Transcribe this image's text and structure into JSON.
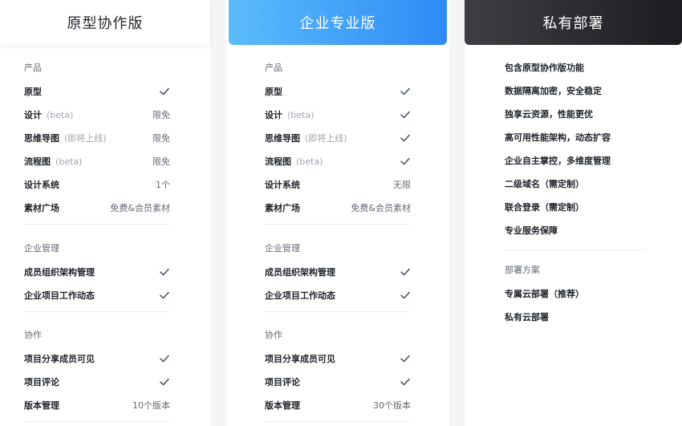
{
  "plans": [
    {
      "name": "原型协作版",
      "sections": [
        {
          "title": "产品",
          "items": [
            {
              "label": "原型",
              "note": "",
              "value": "",
              "check": true
            },
            {
              "label": "设计",
              "note": "(beta)",
              "value": "限免",
              "check": false
            },
            {
              "label": "思维导图",
              "note": "(即将上线)",
              "value": "限免",
              "check": false
            },
            {
              "label": "流程图",
              "note": "(beta)",
              "value": "限免",
              "check": false
            },
            {
              "label": "设计系统",
              "note": "",
              "value": "1个",
              "check": false
            },
            {
              "label": "素材广场",
              "note": "",
              "value": "免费&会员素材",
              "check": false
            }
          ]
        },
        {
          "title": "企业管理",
          "items": [
            {
              "label": "成员组织架构管理",
              "note": "",
              "value": "",
              "check": true
            },
            {
              "label": "企业项目工作动态",
              "note": "",
              "value": "",
              "check": true
            }
          ]
        },
        {
          "title": "协作",
          "items": [
            {
              "label": "项目分享成员可见",
              "note": "",
              "value": "",
              "check": true
            },
            {
              "label": "项目评论",
              "note": "",
              "value": "",
              "check": true
            },
            {
              "label": "版本管理",
              "note": "",
              "value": "10个版本",
              "check": false
            }
          ]
        }
      ]
    },
    {
      "name": "企业专业版",
      "sections": [
        {
          "title": "产品",
          "items": [
            {
              "label": "原型",
              "note": "",
              "value": "",
              "check": true
            },
            {
              "label": "设计",
              "note": "(beta)",
              "value": "",
              "check": true
            },
            {
              "label": "思维导图",
              "note": "(即将上线)",
              "value": "",
              "check": true
            },
            {
              "label": "流程图",
              "note": "(beta)",
              "value": "",
              "check": true
            },
            {
              "label": "设计系统",
              "note": "",
              "value": "无限",
              "check": false
            },
            {
              "label": "素材广场",
              "note": "",
              "value": "免费&会员素材",
              "check": false
            }
          ]
        },
        {
          "title": "企业管理",
          "items": [
            {
              "label": "成员组织架构管理",
              "note": "",
              "value": "",
              "check": true
            },
            {
              "label": "企业项目工作动态",
              "note": "",
              "value": "",
              "check": true
            }
          ]
        },
        {
          "title": "协作",
          "items": [
            {
              "label": "项目分享成员可见",
              "note": "",
              "value": "",
              "check": true
            },
            {
              "label": "项目评论",
              "note": "",
              "value": "",
              "check": true
            },
            {
              "label": "版本管理",
              "note": "",
              "value": "30个版本",
              "check": false
            }
          ]
        }
      ]
    },
    {
      "name": "私有部署",
      "features": [
        "包含原型协作版功能",
        "数据隔离加密，安全稳定",
        "独享云资源，性能更优",
        "高可用性能架构，动态扩容",
        "企业自主掌控，多维度管理",
        "二级域名（需定制）",
        "联合登录（需定制）",
        "专业服务保障"
      ],
      "deploy_title": "部署方案",
      "deploy_options": [
        "专属云部署（推荐）",
        "私有云部署"
      ]
    }
  ],
  "colors": {
    "check": "#4e5969",
    "pro_gradient_start": "#5bbcfb",
    "pro_gradient_end": "#2f8af5",
    "private_gradient_start": "#3d3f44",
    "private_gradient_end": "#1c1d20"
  },
  "icons": {
    "check": "checkmark-icon"
  }
}
